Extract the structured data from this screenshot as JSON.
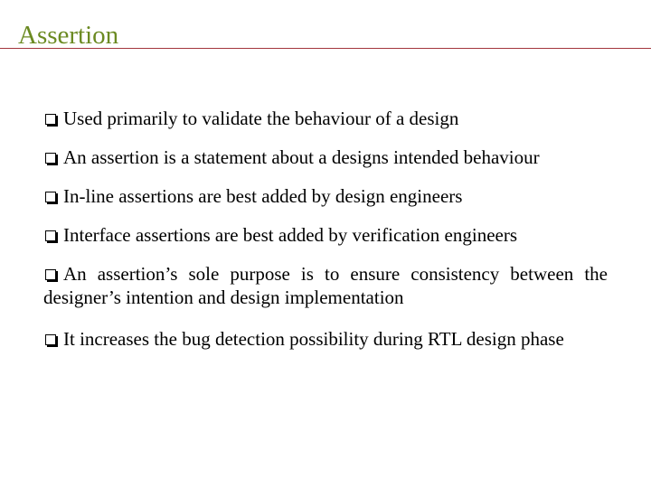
{
  "slide": {
    "title": "Assertion",
    "colors": {
      "title": "#6b8a22",
      "rule": "#a3353d",
      "text": "#000000"
    },
    "bullet_icon": "checkbox-square-icon",
    "bullets": [
      {
        "text": "Used primarily to validate the behaviour of a design"
      },
      {
        "text": "An assertion is a statement about a designs intended behaviour"
      },
      {
        "text": "In-line assertions are best added by design engineers"
      },
      {
        "text": "Interface assertions are best added by verification engineers"
      },
      {
        "text": "An assertion’s sole purpose is to ensure consistency between the designer’s intention and design implementation"
      },
      {
        "text": "It increases the bug detection possibility during RTL design phase"
      }
    ]
  }
}
